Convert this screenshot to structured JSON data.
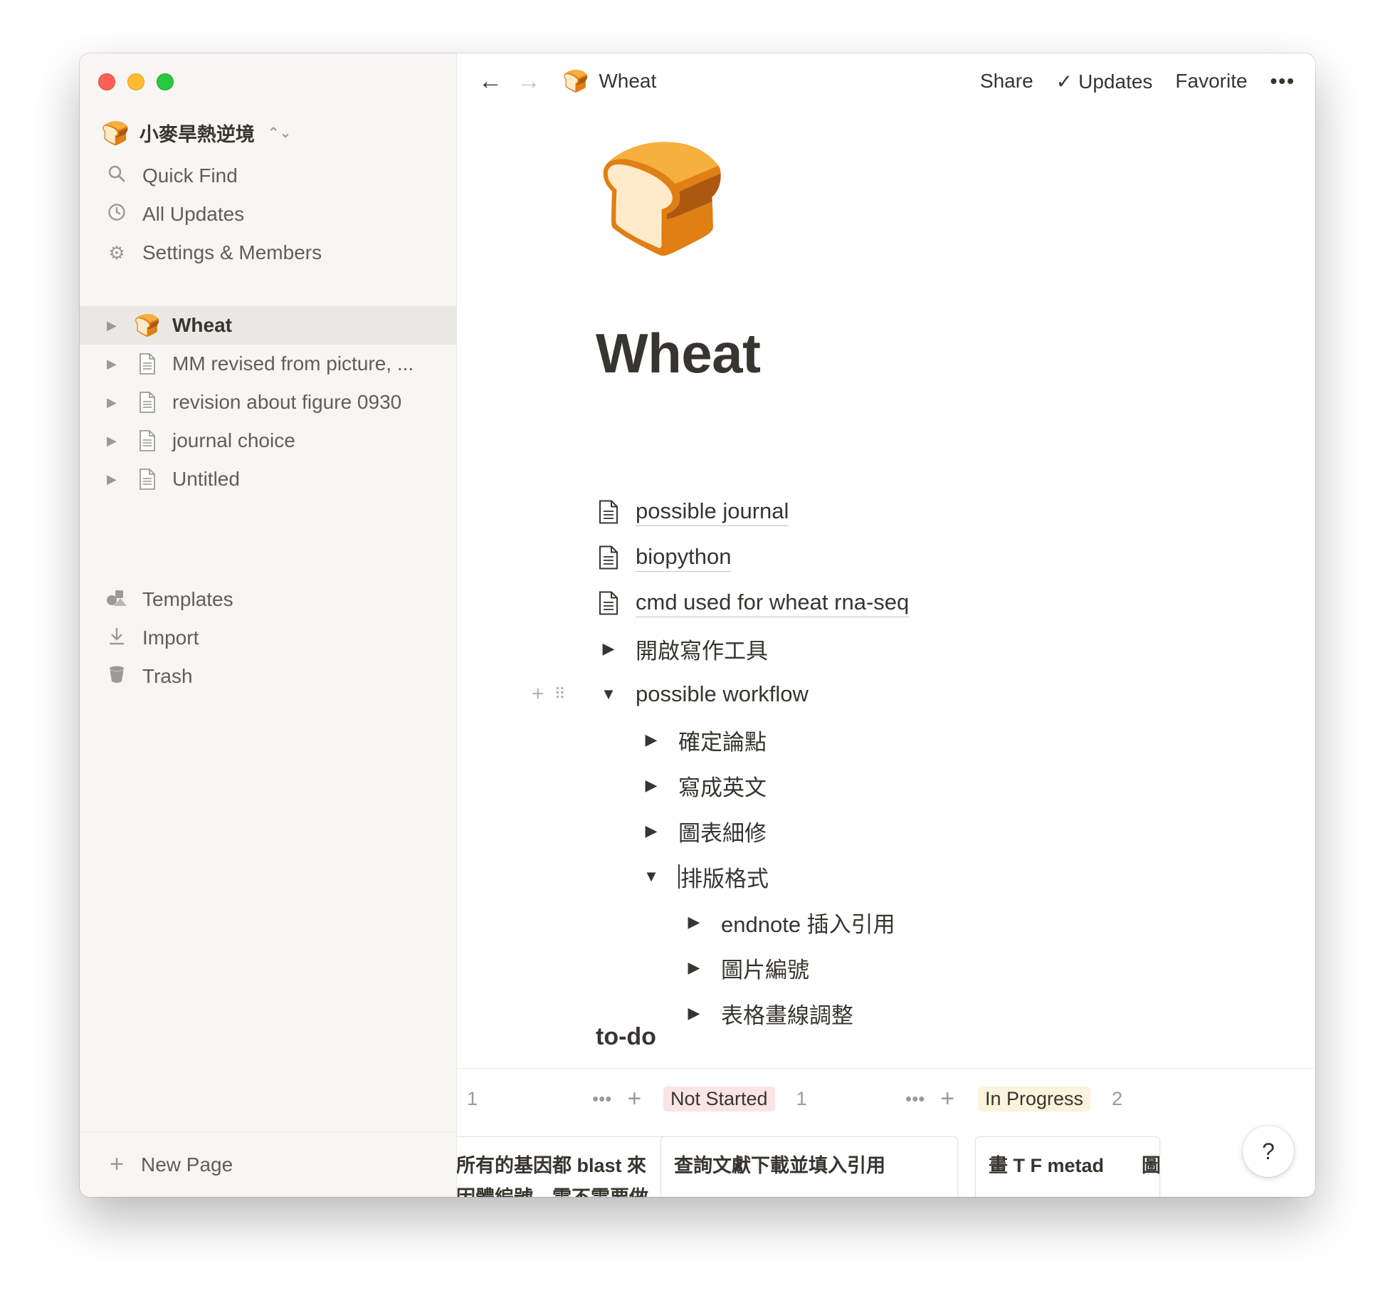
{
  "workspace": {
    "name": "小麥旱熱逆境",
    "icon": "🍞"
  },
  "sidebar": {
    "menu": [
      {
        "label": "Quick Find",
        "icon": "search-icon"
      },
      {
        "label": "All Updates",
        "icon": "clock-icon"
      },
      {
        "label": "Settings & Members",
        "icon": "gear-icon"
      }
    ],
    "pages": [
      {
        "label": "Wheat",
        "icon": "🍞",
        "active": true
      },
      {
        "label": "MM revised from picture, ...",
        "icon": "document-icon"
      },
      {
        "label": "revision about figure 0930",
        "icon": "document-icon"
      },
      {
        "label": "journal choice",
        "icon": "document-icon"
      },
      {
        "label": "Untitled",
        "icon": "document-icon"
      }
    ],
    "tools": [
      {
        "label": "Templates",
        "icon": "templates-icon"
      },
      {
        "label": "Import",
        "icon": "import-icon"
      },
      {
        "label": "Trash",
        "icon": "trash-icon"
      }
    ],
    "new_page": "New Page"
  },
  "topbar": {
    "breadcrumb": "Wheat",
    "share": "Share",
    "updates": "Updates",
    "favorite": "Favorite"
  },
  "page": {
    "icon": "🍞",
    "title": "Wheat",
    "links": [
      "possible journal",
      "biopython",
      "cmd used for wheat rna-seq"
    ],
    "toggles": {
      "writing_tools": "開啟寫作工具",
      "workflow": "possible workflow",
      "workflow_children": [
        "確定論點",
        "寫成英文",
        "圖表細修"
      ],
      "format": "排版格式",
      "format_children": [
        "endnote 插入引用",
        "圖片編號",
        "表格畫線調整"
      ]
    },
    "todo_heading": "to-do"
  },
  "board": {
    "columns": [
      {
        "tag": "",
        "count": "1",
        "card": "所有的基因都 blast 來",
        "card_line2": "因體編號，需不需要做"
      },
      {
        "tag": "Not Started",
        "count": "1",
        "card": "查詢文獻下載並填入引用"
      },
      {
        "tag": "In Progress",
        "count": "2",
        "card": "畫 T F metad",
        "card_tail": "圖"
      }
    ]
  },
  "help": "?",
  "colors": {
    "not_started": "#fbe4e4",
    "in_progress": "#fbf3db",
    "sidebar_bg": "#f7f6f3"
  }
}
